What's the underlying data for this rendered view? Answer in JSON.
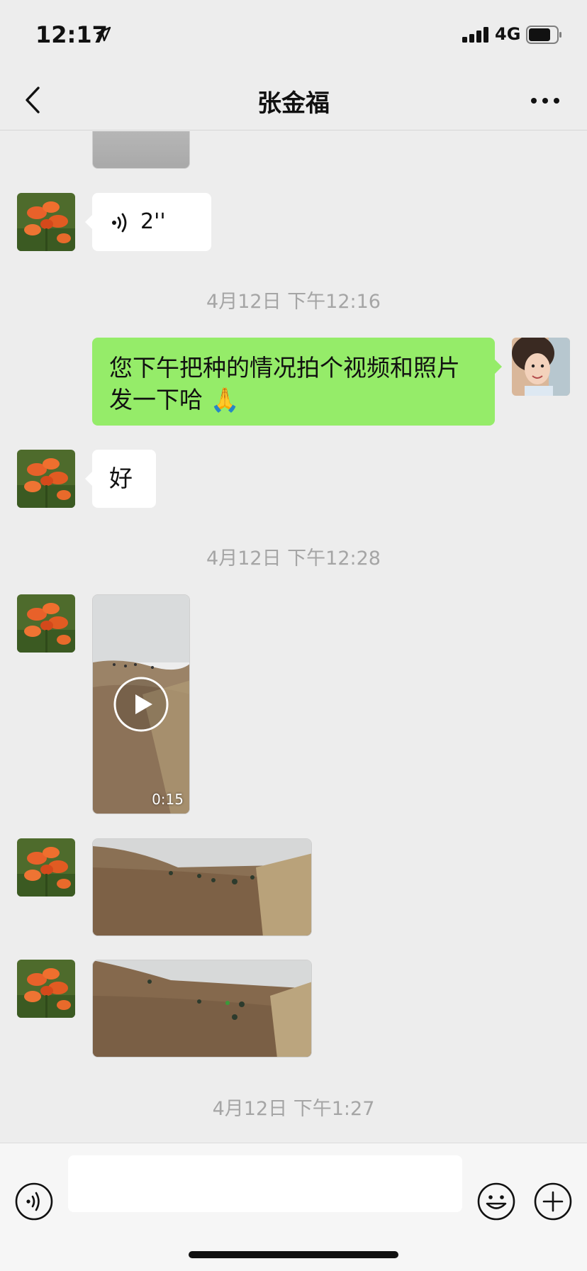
{
  "status_bar": {
    "time": "12:17",
    "network": "4G"
  },
  "nav": {
    "title": "张金福",
    "back_icon": "chevron-left-icon",
    "more_icon": "ellipsis-icon"
  },
  "messages": {
    "voice_duration": "2''",
    "timestamp_1": "4月12日 下午12:16",
    "outgoing_text": "您下午把种的情况拍个视频和照片发一下哈 🙏",
    "reply_text": "好",
    "timestamp_2": "4月12日 下午12:28",
    "video_duration": "0:15",
    "timestamp_3": "4月12日 下午1:27"
  },
  "input_bar": {
    "placeholder": ""
  },
  "colors": {
    "background": "#ededed",
    "outgoing_bubble": "#95ec69",
    "incoming_bubble": "#ffffff",
    "timestamp": "#a5a5a5"
  }
}
